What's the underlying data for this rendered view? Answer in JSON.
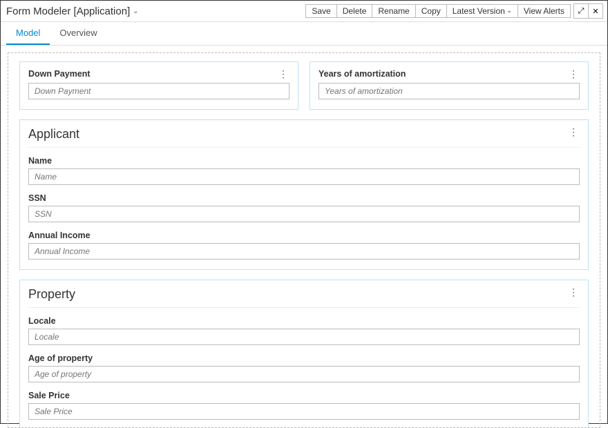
{
  "header": {
    "title": "Form Modeler [Application]",
    "actions": {
      "save": "Save",
      "delete": "Delete",
      "rename": "Rename",
      "copy": "Copy",
      "latestVersion": "Latest Version",
      "viewAlerts": "View Alerts"
    }
  },
  "tabs": {
    "model": "Model",
    "overview": "Overview",
    "active": "model"
  },
  "topFields": {
    "downPayment": {
      "label": "Down Payment",
      "placeholder": "Down Payment"
    },
    "yearsAmort": {
      "label": "Years of amortization",
      "placeholder": "Years of amortization"
    }
  },
  "sections": {
    "applicant": {
      "title": "Applicant",
      "fields": {
        "name": {
          "label": "Name",
          "placeholder": "Name"
        },
        "ssn": {
          "label": "SSN",
          "placeholder": "SSN"
        },
        "annualIncome": {
          "label": "Annual Income",
          "placeholder": "Annual Income"
        }
      }
    },
    "property": {
      "title": "Property",
      "fields": {
        "locale": {
          "label": "Locale",
          "placeholder": "Locale"
        },
        "ageOfProperty": {
          "label": "Age of property",
          "placeholder": "Age of property"
        },
        "salePrice": {
          "label": "Sale Price",
          "placeholder": "Sale Price"
        }
      }
    }
  }
}
